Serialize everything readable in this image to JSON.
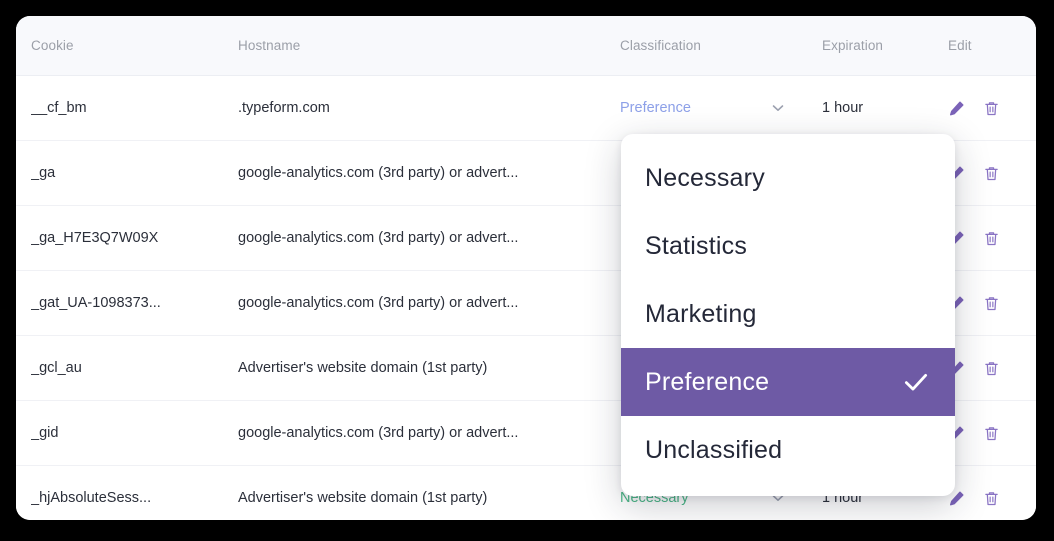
{
  "table": {
    "columns": [
      {
        "key": "cookie",
        "label": "Cookie"
      },
      {
        "key": "hostname",
        "label": "Hostname"
      },
      {
        "key": "classification",
        "label": "Classification"
      },
      {
        "key": "expiration",
        "label": "Expiration"
      },
      {
        "key": "edit",
        "label": "Edit"
      }
    ],
    "rows": [
      {
        "cookie": "__cf_bm",
        "hostname": ".typeform.com",
        "classification": "Preference",
        "classification_color": "#8da0e8",
        "expiration": "1 hour"
      },
      {
        "cookie": "_ga",
        "hostname": "google-analytics.com (3rd party) or advert...",
        "classification": "",
        "classification_color": "",
        "expiration": ""
      },
      {
        "cookie": "_ga_H7E3Q7W09X",
        "hostname": "google-analytics.com (3rd party) or advert...",
        "classification": "",
        "classification_color": "",
        "expiration": ""
      },
      {
        "cookie": "_gat_UA-1098373...",
        "hostname": "google-analytics.com (3rd party) or advert...",
        "classification": "",
        "classification_color": "",
        "expiration": ""
      },
      {
        "cookie": "_gcl_au",
        "hostname": "Advertiser's website domain (1st party)",
        "classification": "",
        "classification_color": "",
        "expiration": ""
      },
      {
        "cookie": "_gid",
        "hostname": "google-analytics.com (3rd party) or advert...",
        "classification": "",
        "classification_color": "",
        "expiration": ""
      },
      {
        "cookie": "_hjAbsoluteSess...",
        "hostname": "Advertiser's website domain (1st party)",
        "classification": "Necessary",
        "classification_color": "#4bb887",
        "expiration": "1 hour"
      }
    ],
    "row_icons": {
      "edit": "pencil-icon",
      "delete": "trash-icon",
      "dropdown": "chevron-down-icon"
    }
  },
  "dropdown": {
    "open": true,
    "selected": "Preference",
    "check_icon": "check-icon",
    "highlight_color": "#6e5aa5",
    "options": [
      {
        "label": "Necessary",
        "selected": false
      },
      {
        "label": "Statistics",
        "selected": false
      },
      {
        "label": "Marketing",
        "selected": false
      },
      {
        "label": "Preference",
        "selected": true
      },
      {
        "label": "Unclassified",
        "selected": false
      }
    ]
  },
  "theme": {
    "accent_purple": "#7b63b8",
    "header_bg": "#f8f9fc",
    "card_bg": "#ffffff",
    "page_bg": "#000000",
    "text_primary": "#2b2f3a",
    "text_muted": "#9b9fa8",
    "classification_blue": "#8da0e8",
    "classification_green": "#4bb887"
  }
}
